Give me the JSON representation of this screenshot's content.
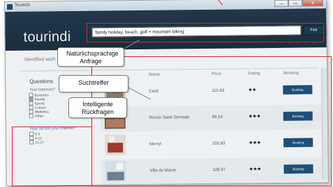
{
  "window": {
    "title": "TourinDi"
  },
  "window_controls": {
    "minimize": "—",
    "maximize": "▭",
    "close": "✕"
  },
  "header": {
    "logo": "tourindi",
    "search_value": "family holiday, beach, golf + mountain biking",
    "find_label": "Find"
  },
  "identified": {
    "label": "Identified wish"
  },
  "questions": {
    "title": "Questions",
    "interests_label": "Your Interests?",
    "interests": [
      {
        "label": "Business",
        "checked": false
      },
      {
        "label": "Family",
        "checked": true
      },
      {
        "label": "Sports",
        "checked": false
      },
      {
        "label": "Culture",
        "checked": false
      },
      {
        "label": "Wellness",
        "checked": false
      },
      {
        "label": "Other",
        "checked": false
      }
    ],
    "children_label": "How old are your children?",
    "children": [
      {
        "label": "0-3",
        "checked": false
      },
      {
        "label": "4-12",
        "checked": false
      },
      {
        "label": "13-17",
        "checked": false
      }
    ]
  },
  "results": {
    "columns": [
      "Name",
      "Price",
      "Rating",
      "Booking"
    ],
    "rows": [
      {
        "name": "Cecil",
        "price": "115.83",
        "rating": "★★",
        "booking": "Booking"
      },
      {
        "name": "Renoir Saint Germain",
        "price": "99.14",
        "rating": "★★★",
        "booking": "Booking"
      },
      {
        "name": "Merryl",
        "price": "102.83",
        "rating": "★★★",
        "booking": "Booking"
      },
      {
        "name": "Villa du Maine",
        "price": "129.97",
        "rating": "★★★",
        "booking": "Booking"
      }
    ]
  },
  "callouts": {
    "natural_language": "Natürlichsprachige Anfrage",
    "search_hits": "Suchtreffer",
    "intelligent_questions": "Intelligente Rückfragen"
  },
  "colors": {
    "header_bg": "#1b2e3e",
    "booking_button": "#1f4e79",
    "annotation_red": "#d8242b"
  }
}
